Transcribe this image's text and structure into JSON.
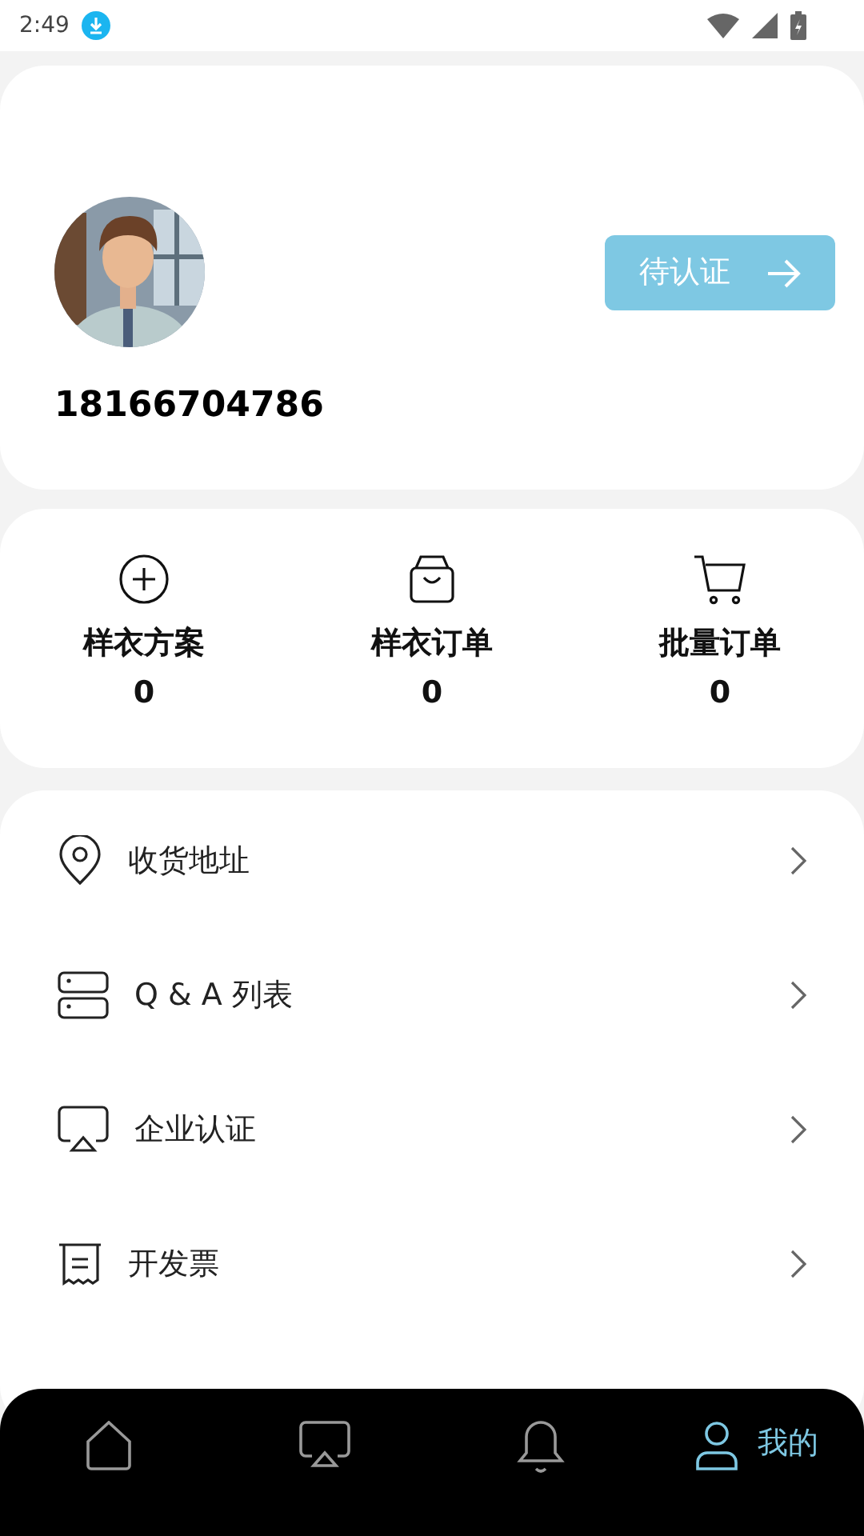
{
  "status_bar": {
    "time": "2:49"
  },
  "profile": {
    "phone": "18166704786",
    "verify_button": "待认证"
  },
  "stats": [
    {
      "kind": "plus",
      "label": "样衣方案",
      "count": "0"
    },
    {
      "kind": "bag",
      "label": "样衣订单",
      "count": "0"
    },
    {
      "kind": "cart",
      "label": "批量订单",
      "count": "0"
    }
  ],
  "menu": [
    {
      "kind": "pin",
      "label": "收货地址"
    },
    {
      "kind": "stack",
      "label": "Q & A 列表"
    },
    {
      "kind": "cast",
      "label": "企业认证"
    },
    {
      "kind": "receipt",
      "label": "开发票"
    }
  ],
  "tab_bar": [
    {
      "kind": "home",
      "selected": false
    },
    {
      "kind": "cast",
      "selected": false
    },
    {
      "kind": "bell",
      "selected": false
    },
    {
      "kind": "person",
      "label": "我的",
      "selected": true
    }
  ]
}
